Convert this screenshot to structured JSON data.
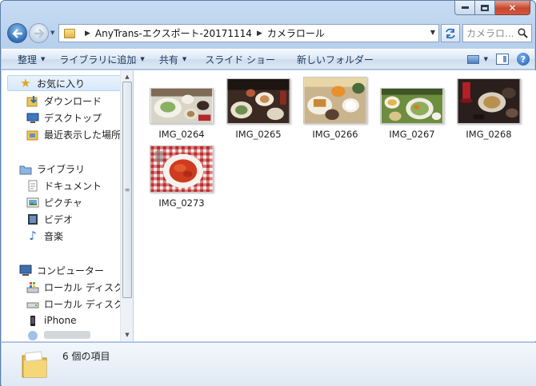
{
  "address": {
    "crumbs": [
      "AnyTrans-エクスポート-20171114",
      "カメラロール"
    ]
  },
  "search": {
    "placeholder": "カメラロ..."
  },
  "toolbar": {
    "organize": "整理",
    "add_to_library": "ライブラリに追加",
    "share": "共有",
    "slideshow": "スライド ショー",
    "new_folder": "新しいフォルダー"
  },
  "nav": {
    "favorites": "お気に入り",
    "downloads": "ダウンロード",
    "desktop": "デスクトップ",
    "recent": "最近表示した場所",
    "libraries": "ライブラリ",
    "documents": "ドキュメント",
    "pictures": "ピクチャ",
    "videos": "ビデオ",
    "music": "音楽",
    "computer": "コンピューター",
    "local_disk_1": "ローカル ディスク (",
    "local_disk_2": "ローカル ディスク (",
    "iphone": "iPhone"
  },
  "files": [
    {
      "name": "IMG_0264"
    },
    {
      "name": "IMG_0265"
    },
    {
      "name": "IMG_0266"
    },
    {
      "name": "IMG_0267"
    },
    {
      "name": "IMG_0268"
    },
    {
      "name": "IMG_0273"
    }
  ],
  "details": {
    "count": "6 個の項目"
  }
}
